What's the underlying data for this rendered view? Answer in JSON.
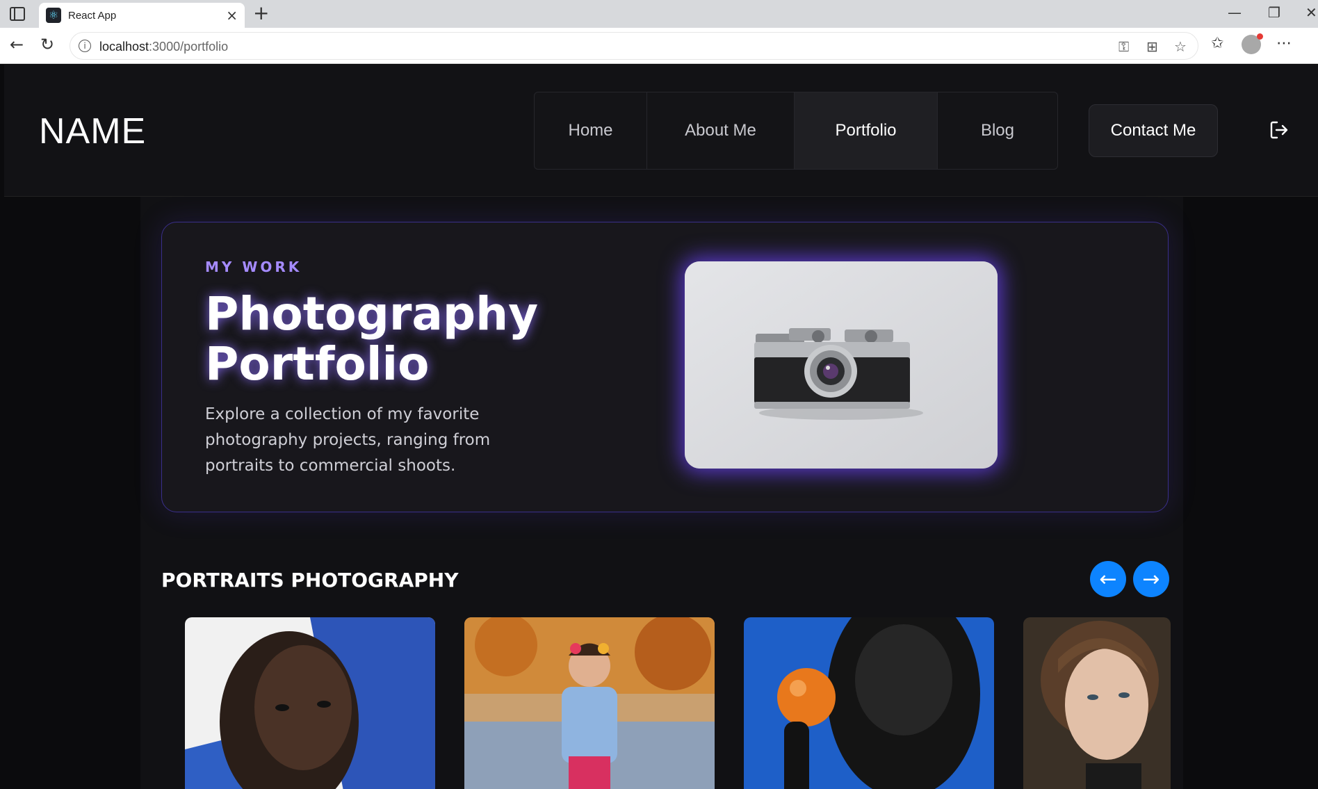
{
  "browser": {
    "tab_title": "React App",
    "url_host": "localhost",
    "url_path": ":3000/portfolio"
  },
  "header": {
    "brand": "NAME",
    "nav": [
      {
        "label": "Home",
        "active": false
      },
      {
        "label": "About Me",
        "active": false
      },
      {
        "label": "Portfolio",
        "active": true
      },
      {
        "label": "Blog",
        "active": false
      }
    ],
    "contact_label": "Contact Me"
  },
  "hero": {
    "kicker": "MY WORK",
    "title_line1": "Photography",
    "title_line2": "Portfolio",
    "description": "Explore a collection of my favorite photography projects, ranging from portraits to commercial shoots."
  },
  "portraits": {
    "title": "PORTRAITS PHOTOGRAPHY",
    "prev_arrow": "←",
    "next_arrow": "→"
  },
  "colors": {
    "accent": "#a58bff",
    "arrow_button": "#0d84ff",
    "hero_border": "#3a2f8a"
  }
}
